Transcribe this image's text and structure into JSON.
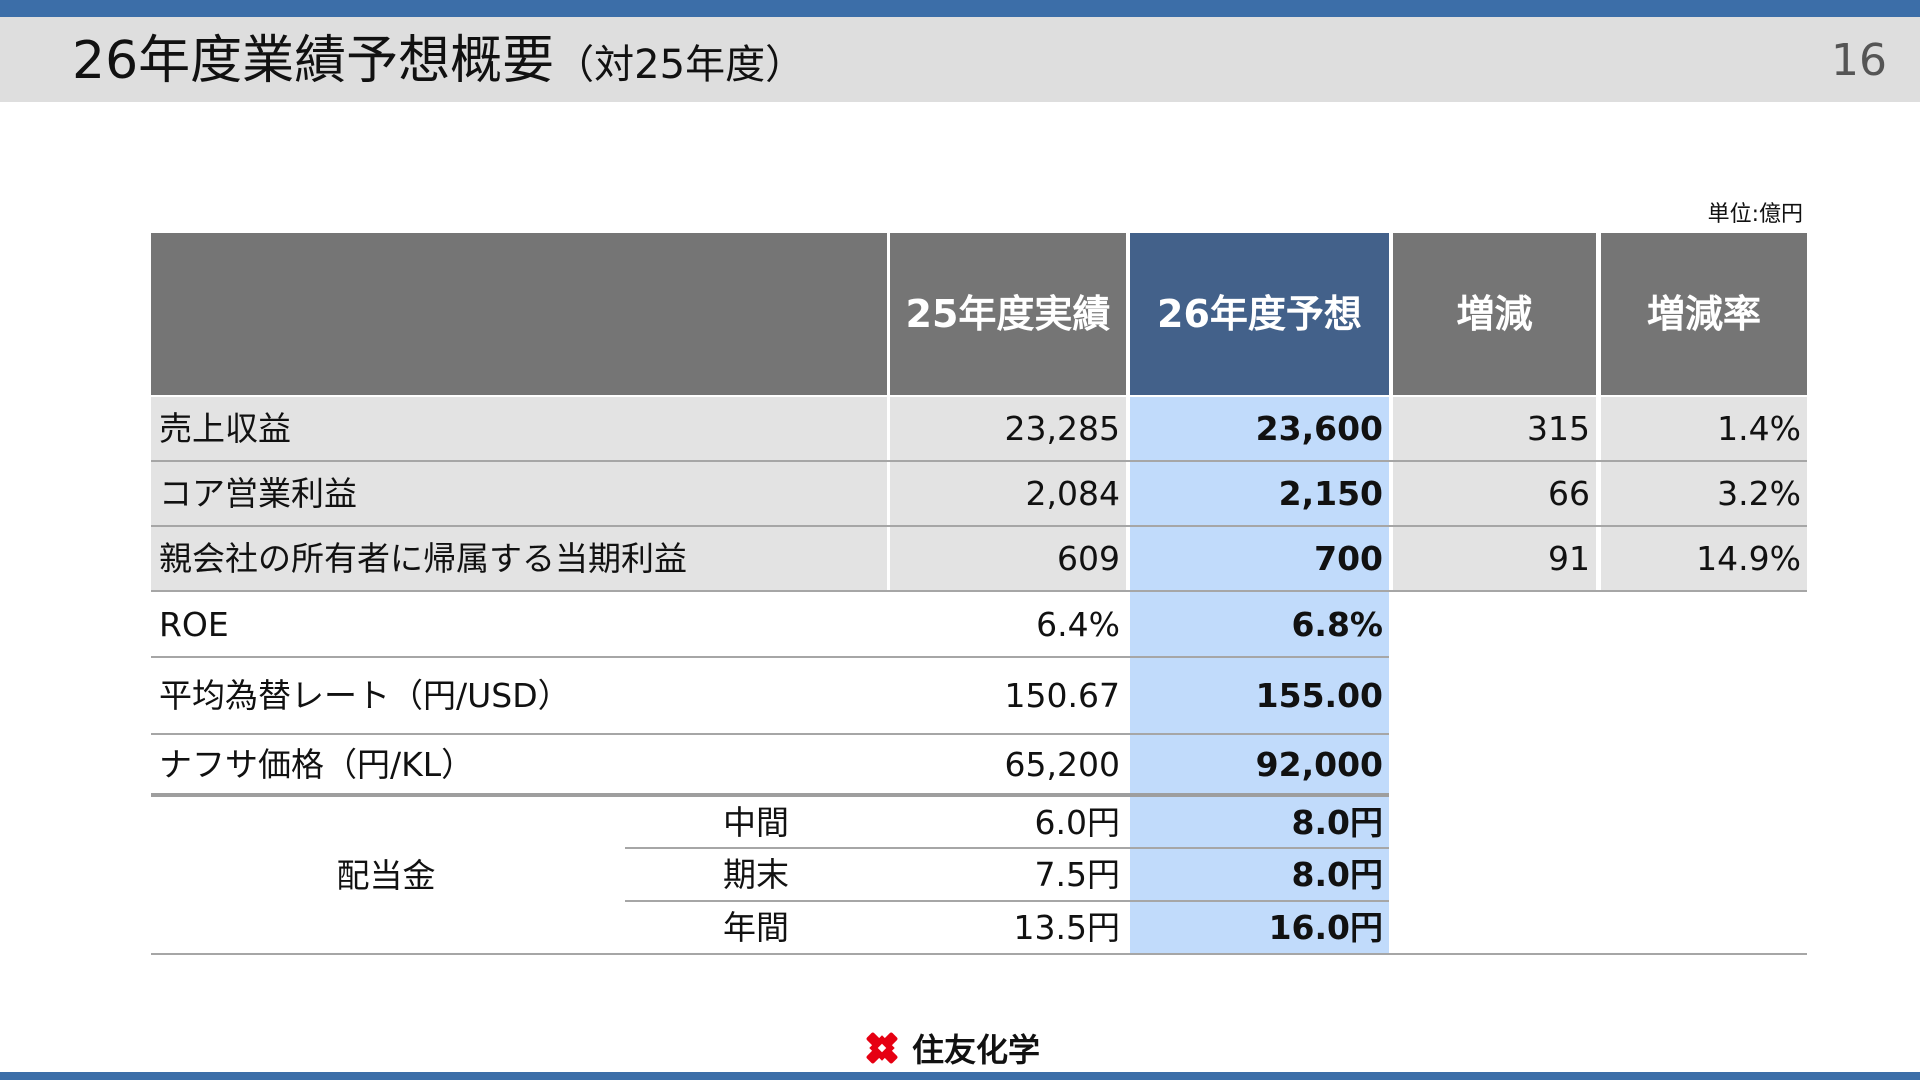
{
  "header": {
    "title": "26年度業績予想概要",
    "subtitle": "（対25年度）",
    "page_number": "16"
  },
  "unit_label": "単位:億円",
  "table": {
    "columns": [
      "25年度実績",
      "26年度予想",
      "増減",
      "増減率"
    ],
    "rows": [
      {
        "label": "売上収益",
        "actual": "23,285",
        "forecast": "23,600",
        "change": "315",
        "rate": "1.4%"
      },
      {
        "label": "コア営業利益",
        "actual": "2,084",
        "forecast": "2,150",
        "change": "66",
        "rate": "3.2%"
      },
      {
        "label": "親会社の所有者に帰属する当期利益",
        "actual": "609",
        "forecast": "700",
        "change": "91",
        "rate": "14.9%"
      },
      {
        "label": "ROE",
        "actual": "6.4%",
        "forecast": "6.8%"
      },
      {
        "label": "平均為替レート（円/USD）",
        "actual": "150.67",
        "forecast": "155.00"
      },
      {
        "label": "ナフサ価格（円/KL）",
        "actual": "65,200",
        "forecast": "92,000"
      }
    ],
    "dividend": {
      "label": "配当金",
      "items": [
        {
          "label": "中間",
          "actual": "6.0円",
          "forecast": "8.0円"
        },
        {
          "label": "期末",
          "actual": "7.5円",
          "forecast": "8.0円"
        },
        {
          "label": "年間",
          "actual": "13.5円",
          "forecast": "16.0円"
        }
      ]
    }
  },
  "footer": {
    "logo_icon": "sumitomo-igeta-icon",
    "company": "住友化学"
  },
  "colors": {
    "accent_bar": "#3c6ea8",
    "header_grey": "#757575",
    "header_forecast": "#43618a",
    "forecast_fill": "#c1dbfb",
    "logo_red": "#e60012"
  }
}
